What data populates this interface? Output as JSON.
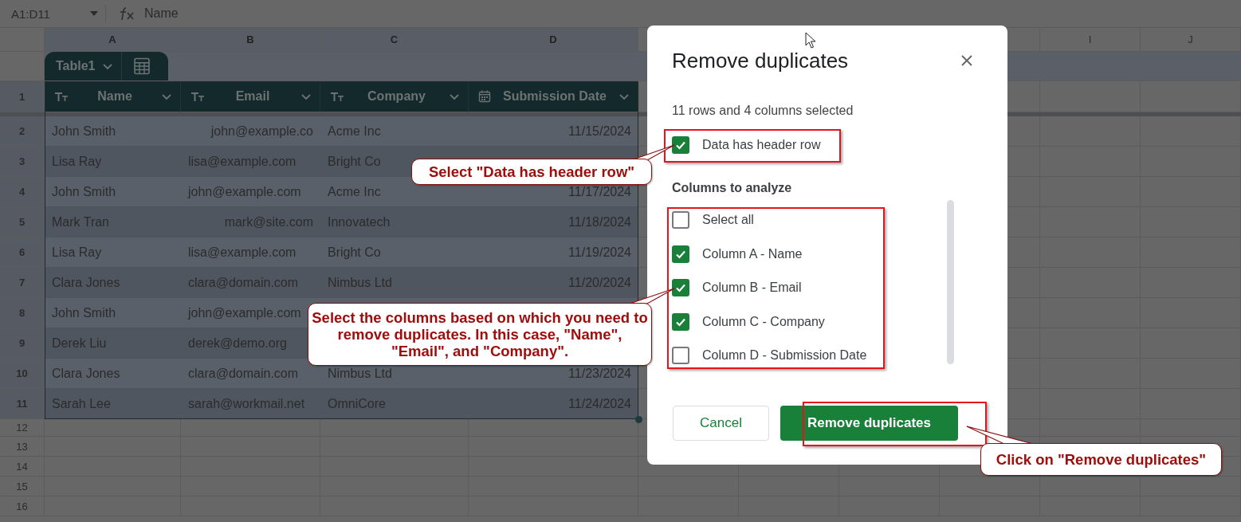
{
  "formula_bar": {
    "cell_range": "A1:D11",
    "formula": "Name"
  },
  "column_headers": {
    "left": [
      {
        "label": "A",
        "selected": true
      },
      {
        "label": "B",
        "selected": true
      },
      {
        "label": "C",
        "selected": true
      },
      {
        "label": "D",
        "selected": true
      }
    ],
    "right": [
      {
        "label": "I",
        "selected": false
      },
      {
        "label": "J",
        "selected": false
      }
    ]
  },
  "table": {
    "name": "Table1",
    "header_row_number": "1",
    "columns": [
      {
        "label": "Name",
        "kind": "text"
      },
      {
        "label": "Email",
        "kind": "text"
      },
      {
        "label": "Company",
        "kind": "text"
      },
      {
        "label": "Submission Date",
        "kind": "date"
      }
    ],
    "rows": [
      {
        "number": "2",
        "name": "John Smith",
        "email": "john@example.co",
        "email_right_aligned": true,
        "company": "Acme Inc",
        "date": "11/15/2024"
      },
      {
        "number": "3",
        "name": "Lisa Ray",
        "email": "lisa@example.com",
        "email_right_aligned": false,
        "company": "Bright Co",
        "date": null
      },
      {
        "number": "4",
        "name": "John Smith",
        "email": "john@example.com",
        "email_right_aligned": false,
        "company": "Acme Inc",
        "date": "11/17/2024"
      },
      {
        "number": "5",
        "name": "Mark Tran",
        "email": "mark@site.com",
        "email_right_aligned": true,
        "company": "Innovatech",
        "date": "11/18/2024"
      },
      {
        "number": "6",
        "name": "Lisa Ray",
        "email": "lisa@example.com",
        "email_right_aligned": false,
        "company": "Bright Co",
        "date": "11/19/2024"
      },
      {
        "number": "7",
        "name": "Clara Jones",
        "email": "clara@domain.com",
        "email_right_aligned": false,
        "company": "Nimbus Ltd",
        "date": "11/20/2024"
      },
      {
        "number": "8",
        "name": "John Smith",
        "email": "john@example.com",
        "email_right_aligned": false,
        "company": null,
        "date": null
      },
      {
        "number": "9",
        "name": "Derek Liu",
        "email": "derek@demo.org",
        "email_right_aligned": false,
        "company": null,
        "date": null
      },
      {
        "number": "10",
        "name": "Clara Jones",
        "email": "clara@domain.com",
        "email_right_aligned": false,
        "company": "Nimbus Ltd",
        "date": "11/23/2024"
      },
      {
        "number": "11",
        "name": "Sarah Lee",
        "email": "sarah@workmail.net",
        "email_right_aligned": false,
        "company": "OmniCore",
        "date": "11/24/2024"
      }
    ]
  },
  "empty_rows": [
    "12",
    "13",
    "14",
    "15",
    "16"
  ],
  "dialog": {
    "title": "Remove duplicates",
    "summary": "11 rows and 4 columns selected",
    "header_option": {
      "label": "Data has header row",
      "checked": true
    },
    "columns_heading": "Columns to analyze",
    "column_options": [
      {
        "label": "Select all",
        "checked": false
      },
      {
        "label": "Column A - Name",
        "checked": true
      },
      {
        "label": "Column B - Email",
        "checked": true
      },
      {
        "label": "Column C - Company",
        "checked": true
      },
      {
        "label": "Column D - Submission Date",
        "checked": false
      }
    ],
    "buttons": [
      {
        "label": "Cancel",
        "kind": "secondary"
      },
      {
        "label": "Remove duplicates",
        "kind": "primary"
      }
    ]
  },
  "callouts": [
    {
      "text": "Select \"Data has header row\""
    },
    {
      "text": "Select the columns based on which you need to remove duplicates. In this case, \"Name\", \"Email\", and \"Company\"."
    },
    {
      "text": "Click on \"Remove duplicates\""
    }
  ]
}
